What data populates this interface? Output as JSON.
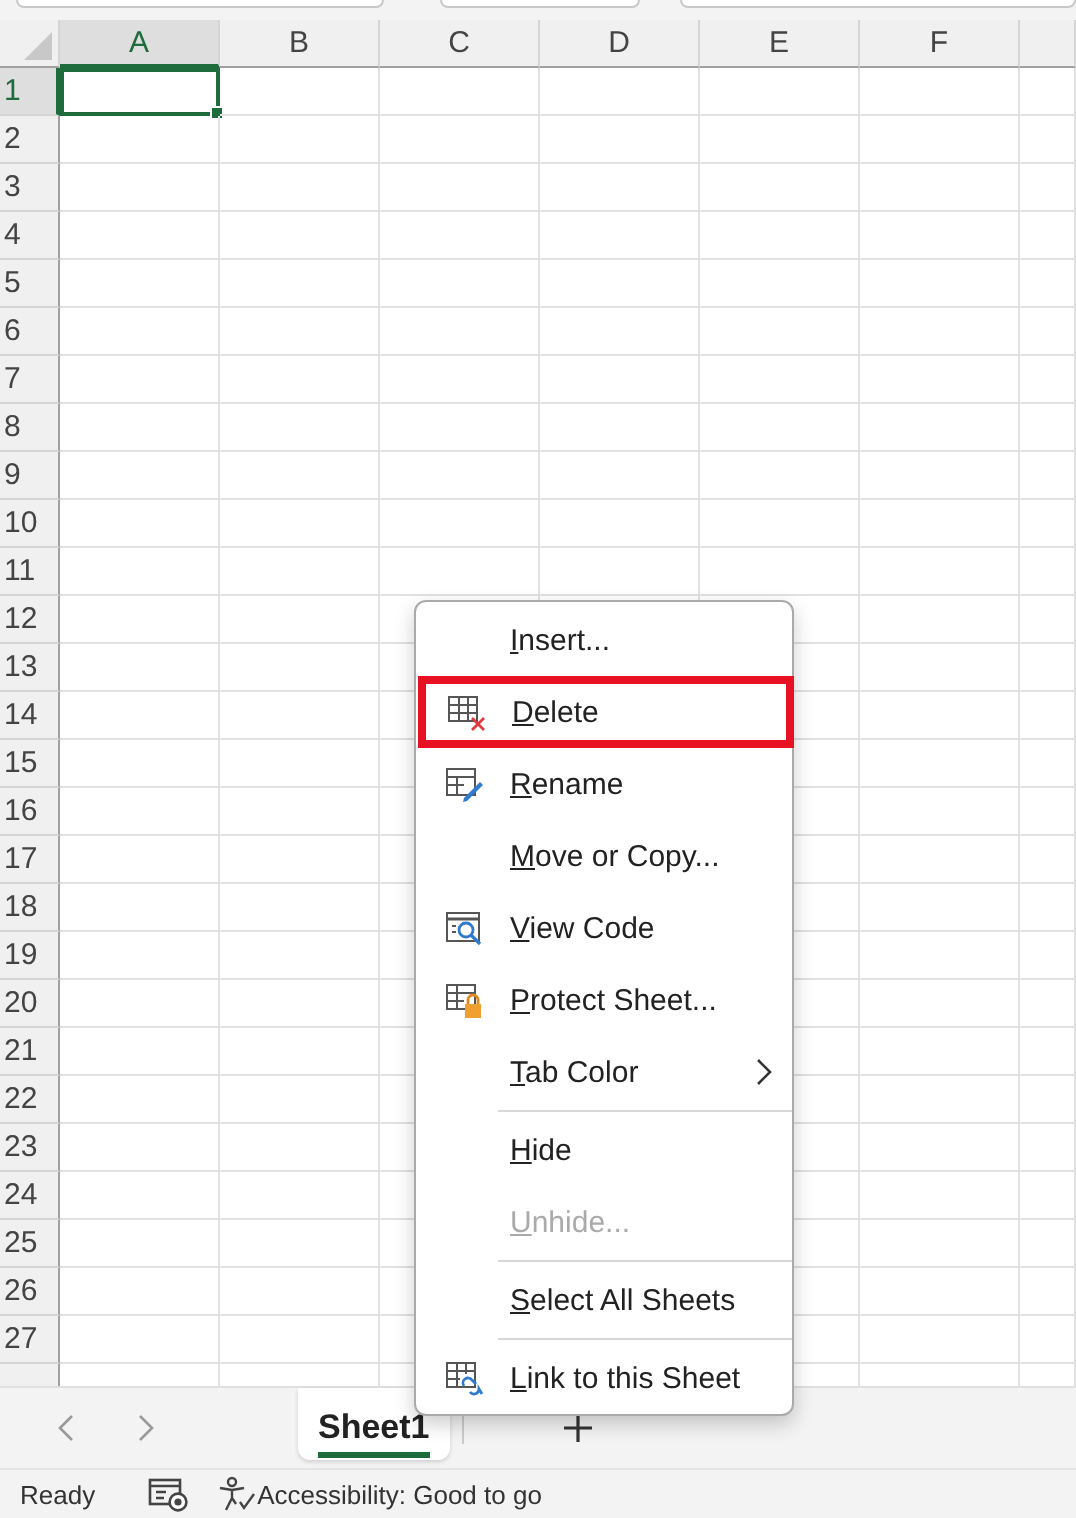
{
  "columns": [
    {
      "label": "A",
      "selected": true
    },
    {
      "label": "B",
      "selected": false
    },
    {
      "label": "C",
      "selected": false
    },
    {
      "label": "D",
      "selected": false
    },
    {
      "label": "E",
      "selected": false
    },
    {
      "label": "F",
      "selected": false
    }
  ],
  "rows": [
    {
      "label": "1",
      "selected": true
    },
    {
      "label": "2",
      "selected": false
    },
    {
      "label": "3",
      "selected": false
    },
    {
      "label": "4",
      "selected": false
    },
    {
      "label": "5",
      "selected": false
    },
    {
      "label": "6",
      "selected": false
    },
    {
      "label": "7",
      "selected": false
    },
    {
      "label": "8",
      "selected": false
    },
    {
      "label": "9",
      "selected": false
    },
    {
      "label": "10",
      "selected": false
    },
    {
      "label": "11",
      "selected": false
    },
    {
      "label": "12",
      "selected": false
    },
    {
      "label": "13",
      "selected": false
    },
    {
      "label": "14",
      "selected": false
    },
    {
      "label": "15",
      "selected": false
    },
    {
      "label": "16",
      "selected": false
    },
    {
      "label": "17",
      "selected": false
    },
    {
      "label": "18",
      "selected": false
    },
    {
      "label": "19",
      "selected": false
    },
    {
      "label": "20",
      "selected": false
    },
    {
      "label": "21",
      "selected": false
    },
    {
      "label": "22",
      "selected": false
    },
    {
      "label": "23",
      "selected": false
    },
    {
      "label": "24",
      "selected": false
    },
    {
      "label": "25",
      "selected": false
    },
    {
      "label": "26",
      "selected": false
    },
    {
      "label": "27",
      "selected": false
    }
  ],
  "context_menu": [
    {
      "kind": "plain",
      "label": "Insert...",
      "highlighted": false,
      "disabled": false
    },
    {
      "kind": "delete",
      "label": "Delete",
      "highlighted": true,
      "disabled": false
    },
    {
      "kind": "rename",
      "label": "Rename",
      "highlighted": false,
      "disabled": false
    },
    {
      "kind": "plain",
      "label": "Move or Copy...",
      "highlighted": false,
      "disabled": false
    },
    {
      "kind": "code",
      "label": "View Code",
      "highlighted": false,
      "disabled": false
    },
    {
      "kind": "protect",
      "label": "Protect Sheet...",
      "highlighted": false,
      "disabled": false
    },
    {
      "kind": "submenu",
      "label": "Tab Color",
      "highlighted": false,
      "disabled": false
    },
    {
      "kind": "separator"
    },
    {
      "kind": "plain",
      "label": "Hide",
      "highlighted": false,
      "disabled": false
    },
    {
      "kind": "plain",
      "label": "Unhide...",
      "highlighted": false,
      "disabled": true
    },
    {
      "kind": "separator"
    },
    {
      "kind": "plain",
      "label": "Select All Sheets",
      "highlighted": false,
      "disabled": false
    },
    {
      "kind": "separator"
    },
    {
      "kind": "link",
      "label": "Link to this Sheet",
      "highlighted": false,
      "disabled": false
    }
  ],
  "sheet_tabs": [
    {
      "label": "Sheet1",
      "selected": true
    }
  ],
  "status_bar": {
    "status": "Ready",
    "accessibility": "Accessibility: Good to go"
  }
}
